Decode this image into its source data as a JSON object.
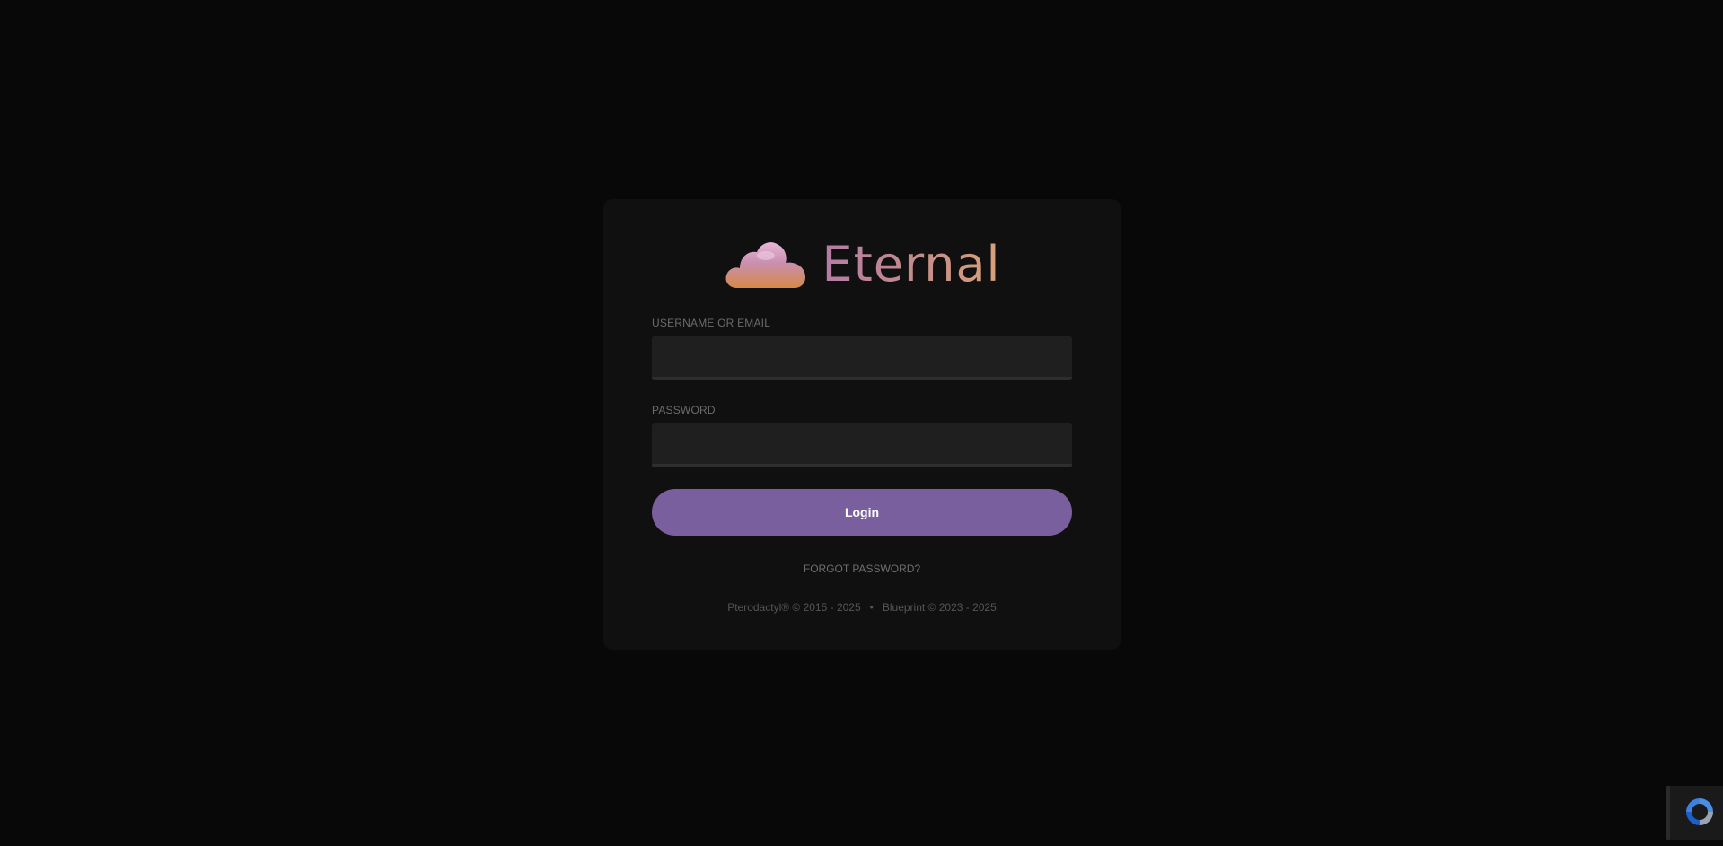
{
  "brand": {
    "logo_icon": "cloud-logo-icon",
    "name": "Eternal",
    "gradient_colors": [
      "#b57ba6",
      "#d9a17a"
    ]
  },
  "form": {
    "username_label": "USERNAME OR EMAIL",
    "username_value": "",
    "password_label": "PASSWORD",
    "password_value": "",
    "login_label": "Login",
    "forgot_label": "FORGOT PASSWORD?"
  },
  "footer": {
    "pterodactyl": "Pterodactyl® © 2015 - 2025",
    "separator": "•",
    "blueprint": "Blueprint © 2023 - 2025"
  },
  "recaptcha": {
    "icon": "recaptcha-icon"
  },
  "colors": {
    "background": "#080808",
    "card": "#101010",
    "input": "#1f1f1f",
    "accent": "#7a5f9e"
  }
}
